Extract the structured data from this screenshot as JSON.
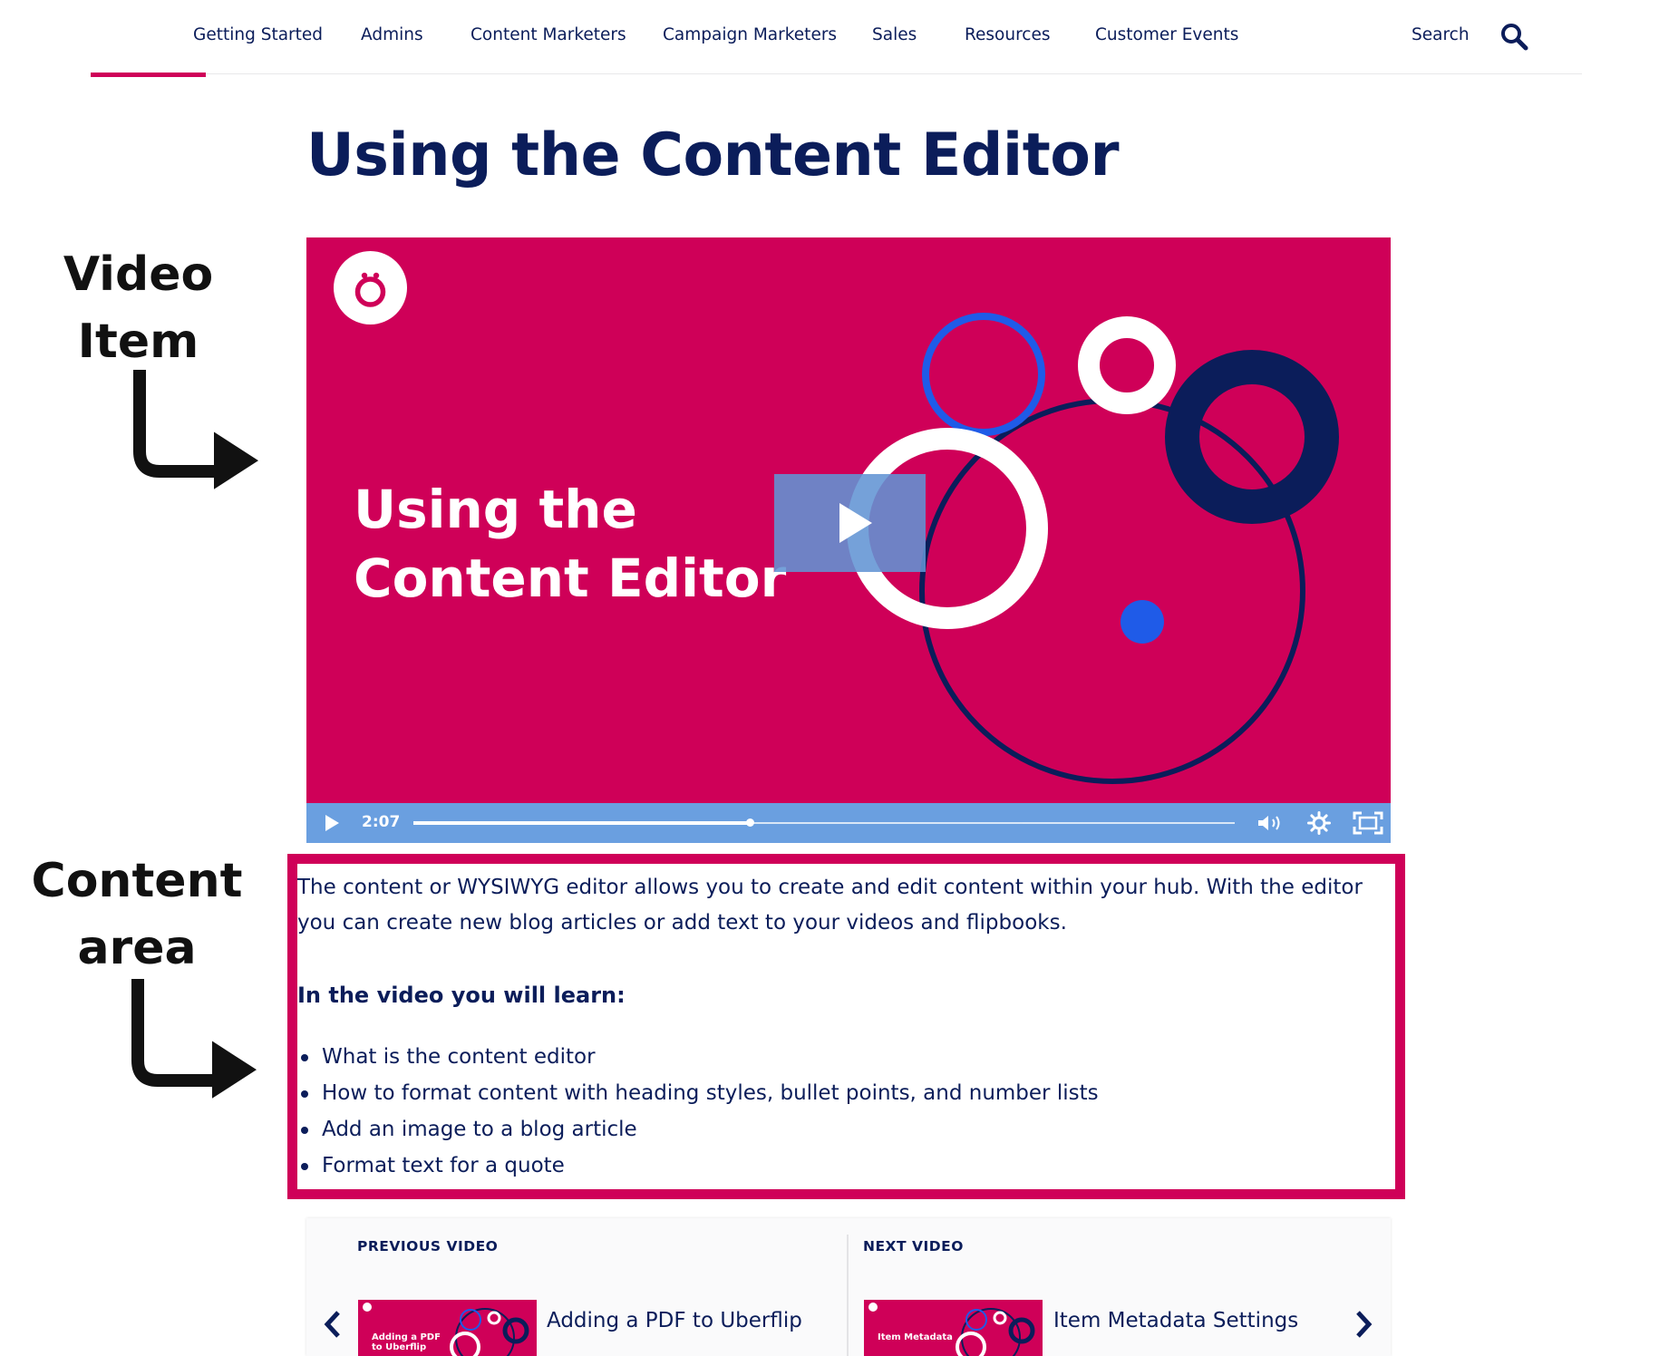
{
  "nav": {
    "items": [
      "Getting Started",
      "Admins",
      "Content Marketers",
      "Campaign Marketers",
      "Sales",
      "Resources",
      "Customer Events"
    ],
    "search_label": "Search"
  },
  "page_title": "Using the Content Editor",
  "annotations": {
    "video_item": [
      "Video",
      "Item"
    ],
    "content_area": [
      "Content",
      "area"
    ]
  },
  "video": {
    "title_lines": [
      "Using the",
      "Content Editor"
    ],
    "time": "2:07",
    "progress_fraction": 0.41
  },
  "content": {
    "intro": "The content or WYSIWYG editor allows you to create and edit content within your hub. With the editor you can create new blog articles or add text to your videos and flipbooks.",
    "learn_heading": "In the video you will learn:",
    "bullets": [
      "What is the content editor",
      "How to format content with heading styles, bullet points, and number lists",
      "Add an image to a blog article",
      "Format text for a quote"
    ]
  },
  "prev_next": {
    "previous_label": "PREVIOUS VIDEO",
    "previous_title": "Adding a PDF to Uberflip",
    "previous_thumb_text": "Adding a PDF to Uberflip",
    "next_label": "NEXT VIDEO",
    "next_title": "Item Metadata Settings",
    "next_thumb_text": "Item Metadata"
  },
  "colors": {
    "brand_pink": "#cf0058",
    "navy": "#0b1d5a",
    "control_blue": "#6a9fe0",
    "accent_blue": "#1f5be8"
  }
}
